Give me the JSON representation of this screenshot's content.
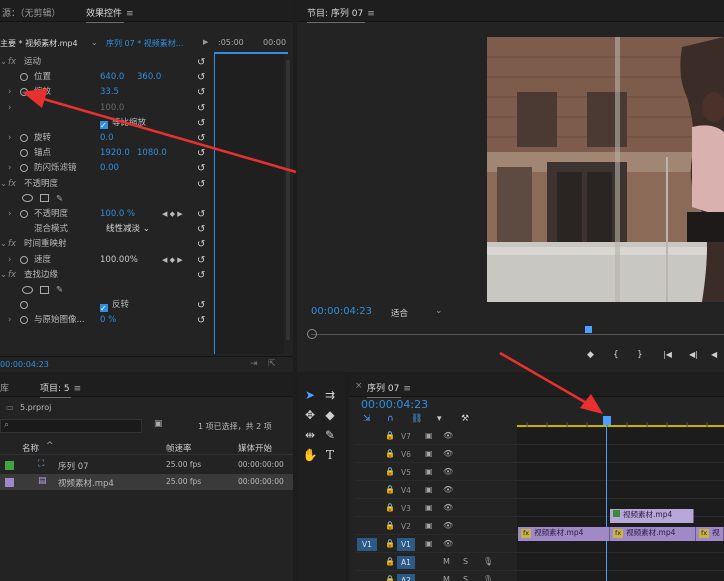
{
  "effect_controls": {
    "source_tab": "源：（无剪辑）",
    "tab": "效果控件",
    "menu_glyph": "≡",
    "master_label": "主要 * 视频素材.mp4",
    "seq_label": "序列 07 * 视频素材...",
    "ruler_t1": ":05:00",
    "ruler_t2": "00:00",
    "rows": [
      {
        "indent": 1,
        "fx": true,
        "label": "运动"
      },
      {
        "indent": 2,
        "watch": true,
        "label": "位置",
        "v1": "640.0",
        "v2": "360.0"
      },
      {
        "indent": 2,
        "twist": true,
        "watch": true,
        "label": "缩放",
        "v1": "33.5"
      },
      {
        "indent": 2,
        "twist": true,
        "watch": false,
        "label": "",
        "v1": "100.0",
        "dimv": true
      },
      {
        "indent": 3,
        "check": true,
        "label": "等比缩放"
      },
      {
        "indent": 2,
        "twist": true,
        "watch": true,
        "label": "旋转",
        "v1": "0.0"
      },
      {
        "indent": 2,
        "watch": true,
        "label": "锚点",
        "v1": "1920.0",
        "v2": "1080.0"
      },
      {
        "indent": 2,
        "twist": true,
        "watch": true,
        "label": "防闪烁滤镜",
        "v1": "0.00"
      },
      {
        "indent": 1,
        "fx": true,
        "label": "不透明度"
      },
      {
        "indent": 2,
        "shapes": true
      },
      {
        "indent": 2,
        "twist": true,
        "watch": true,
        "label": "不透明度",
        "v1": "100.0 %",
        "keys": true
      },
      {
        "indent": 2,
        "label": "混合模式",
        "select": "线性减淡"
      },
      {
        "indent": 1,
        "fx": true,
        "label": "时间重映射"
      },
      {
        "indent": 2,
        "twist": true,
        "watch": true,
        "label": "速度",
        "v1": "100.00%",
        "keys": true,
        "dimv": true
      },
      {
        "indent": 1,
        "fx": true,
        "label": "查找边缘"
      },
      {
        "indent": 2,
        "shapes": true
      },
      {
        "indent": 2,
        "watch": true,
        "label": "",
        "check": true,
        "checklabel": "反转"
      },
      {
        "indent": 2,
        "twist": true,
        "watch": true,
        "label": "与原始图像...",
        "v1": "0 %"
      }
    ],
    "timecode": "00:00:04:23"
  },
  "program_monitor": {
    "tab": "节目: 序列 07",
    "menu_glyph": "≡",
    "timecode": "00:00:04:23",
    "fit": "适合",
    "controls": [
      "◆",
      "{",
      "}",
      "|◀",
      "◀|",
      "◀",
      "▶"
    ]
  },
  "project": {
    "tab_lib": "库",
    "tab": "项目: 5",
    "menu_glyph": "≡",
    "file": "5.prproj",
    "selection": "1 项已选择，共 2 项",
    "col_name": "名称",
    "col_fps": "帧速率",
    "col_start": "媒体开始",
    "items": [
      {
        "color": "#3fa33f",
        "name": "序列 07",
        "fps": "25.00 fps",
        "start": "00:00:00:00",
        "type": "sequence"
      },
      {
        "color": "#9d88c9",
        "name": "视频素材.mp4",
        "fps": "25.00 fps",
        "start": "00:00:00:00",
        "type": "clip"
      }
    ]
  },
  "timeline": {
    "tab": "序列 07",
    "menu_glyph": "≡",
    "timecode": "00:00:04:23",
    "tracks": [
      "V7",
      "V6",
      "V5",
      "V4",
      "V3",
      "V2",
      "V1",
      "A1",
      "A2"
    ],
    "clip_v2": "视频素材.mp4",
    "clip_v1": [
      "视频素材.mp4",
      "视频素材.mp4",
      "视"
    ],
    "fx_badge": "fx"
  },
  "colors": {
    "accent": "#2f8fe0",
    "playhead": "#4aa0ff",
    "clip": "#a089c7",
    "annotation": "#e8312f"
  }
}
